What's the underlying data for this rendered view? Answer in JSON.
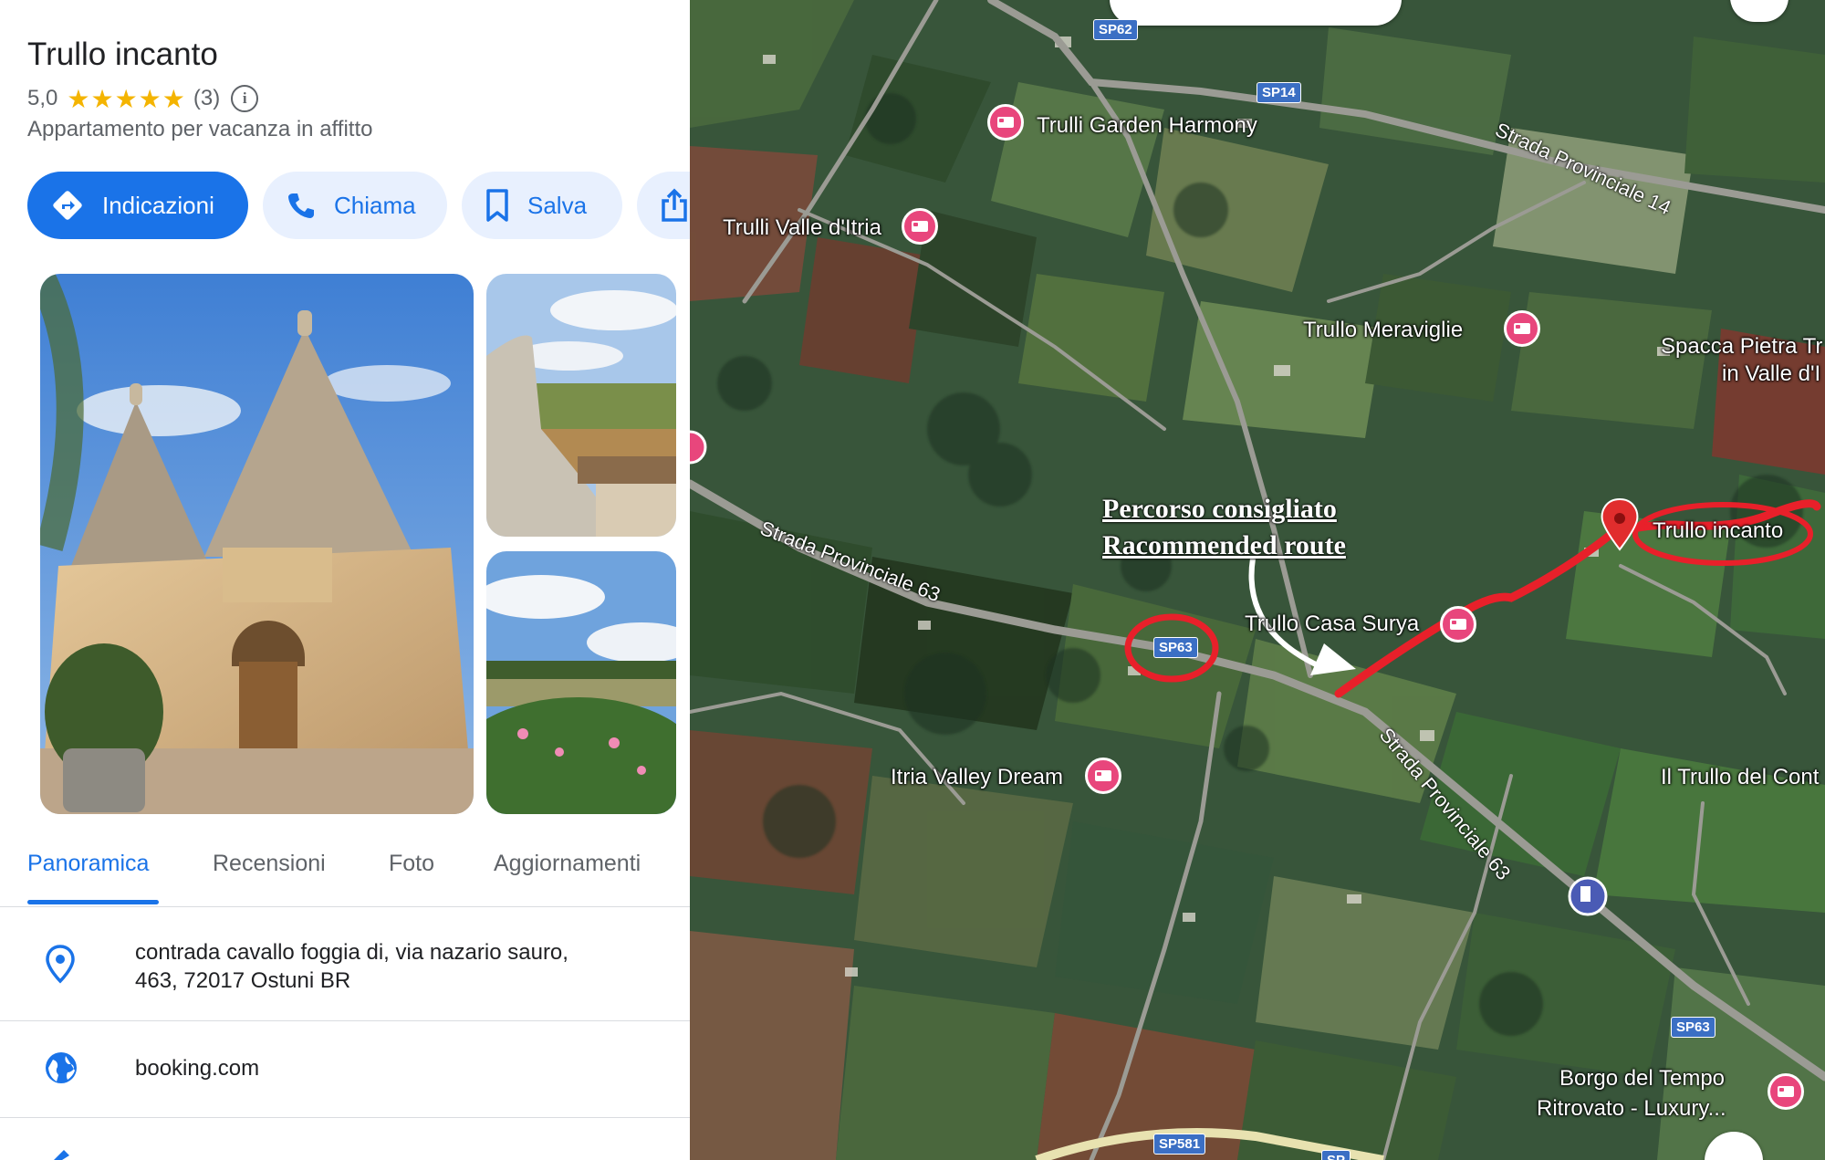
{
  "place": {
    "name": "Trullo incanto",
    "rating": "5,0",
    "stars": "★★★★★",
    "review_count": "(3)",
    "category": "Appartamento per vacanza in affitto"
  },
  "actions": {
    "directions": "Indicazioni",
    "call": "Chiama",
    "save": "Salva"
  },
  "tabs": [
    "Panoramica",
    "Recensioni",
    "Foto",
    "Aggiornamenti"
  ],
  "details": {
    "address": "contrada cavallo foggia di, via nazario sauro, 463, 72017 Ostuni BR",
    "address_line1": "contrada cavallo foggia di, via nazario sauro,",
    "address_line2": "463, 72017 Ostuni BR",
    "website": "booking.com"
  },
  "map": {
    "pois": {
      "trulli_garden": "Trulli Garden Harmony",
      "valle_itria": "Trulli Valle d'Itria",
      "meraviglie": "Trullo Meraviglie",
      "spacca_1": "Spacca Pietra Tr",
      "spacca_2": "in Valle d'I",
      "trullo_incanto": "Trullo incanto",
      "casa_surya": "Trullo Casa Surya",
      "itria_dream": "Itria Valley Dream",
      "trullo_del_cont": "Il Trullo del Cont",
      "borgo_1": "Borgo del Tempo",
      "borgo_2": "Ritrovato - Luxury..."
    },
    "roads": {
      "sp14_name": "Strada Provinciale 14",
      "sp63_name_a": "Strada Provinciale 63",
      "sp63_name_b": "Strada Provinciale 63"
    },
    "shields": {
      "sp62": "SP62",
      "sp14": "SP14",
      "sp63_a": "SP63",
      "sp63_b": "SP63",
      "sp581": "SP581",
      "sp_partial": "SP"
    },
    "annotation": {
      "line1": "Percorso consigliato",
      "line2": "Racommended route"
    },
    "colors": {
      "route": "#e8202a",
      "poi_pink": "#e8467c",
      "shield_blue": "#3b6fc4",
      "accent_blue": "#1a73e8"
    }
  }
}
